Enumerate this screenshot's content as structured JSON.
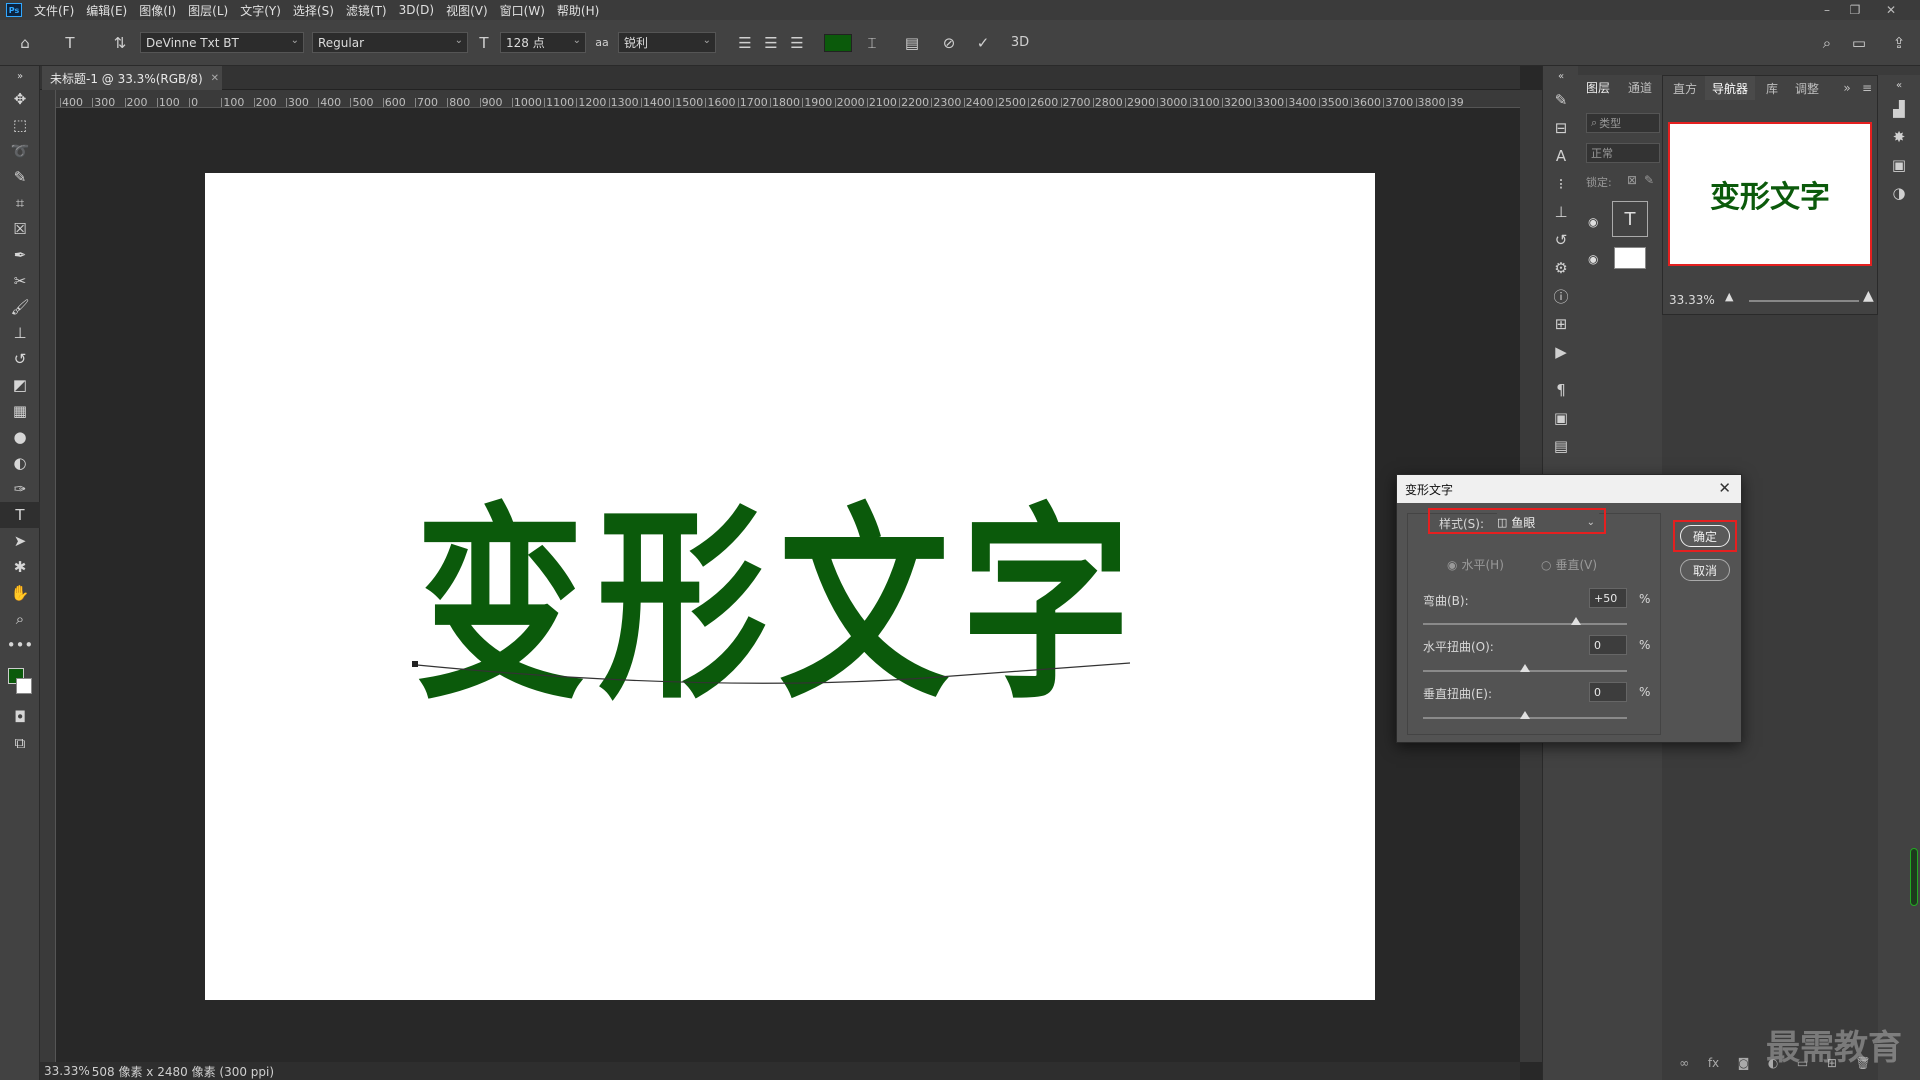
{
  "menubar": {
    "logo": "Ps",
    "items": [
      "文件(F)",
      "编辑(E)",
      "图像(I)",
      "图层(L)",
      "文字(Y)",
      "选择(S)",
      "滤镜(T)",
      "3D(D)",
      "视图(V)",
      "窗口(W)",
      "帮助(H)"
    ]
  },
  "options": {
    "font_family": "DeVinne Txt BT",
    "font_style": "Regular",
    "font_size": "128 点",
    "aa_label": "aa",
    "antialias": "锐利",
    "text_color": "#0b5a0b",
    "threed_label": "3D"
  },
  "document": {
    "tab_title": "未标题-1 @ 33.3%(RGB/8)",
    "canvas_text": "变形文字",
    "text_color": "#0b5a0b"
  },
  "ruler": {
    "h_labels": [
      "400",
      "300",
      "200",
      "100",
      "0",
      "100",
      "200",
      "300",
      "400",
      "500",
      "600",
      "700",
      "800",
      "900",
      "1000",
      "1100",
      "1200",
      "1300",
      "1400",
      "1500",
      "1600",
      "1700",
      "1800",
      "1900",
      "2000",
      "2100",
      "2200",
      "2300",
      "2400",
      "2500",
      "2600",
      "2700",
      "2800",
      "2900",
      "3000",
      "3100",
      "3200",
      "3300",
      "3400",
      "3500",
      "3600",
      "3700",
      "3800",
      "39"
    ]
  },
  "status": {
    "zoom": "33.33%",
    "doc_size": "508 像素 x 2480 像素 (300 ppi)"
  },
  "panels": {
    "tabs_left": [
      "图层",
      "通道"
    ],
    "tabs_right": [
      "直方",
      "导航器",
      "库",
      "调整"
    ],
    "search_label": "类型",
    "blend_mode": "正常",
    "lock_label": "锁定:",
    "layer_text_icon": "T",
    "nav_zoom": "33.33%",
    "nav_thumb_text": "变形文字"
  },
  "dialog": {
    "title": "变形文字",
    "style_label": "样式(S):",
    "style_value": "鱼眼",
    "horizontal_label": "水平(H)",
    "vertical_label": "垂直(V)",
    "bend_label": "弯曲(B):",
    "bend_value": "+50",
    "bend_percent": 50,
    "hdist_label": "水平扭曲(O):",
    "hdist_value": "0",
    "vdist_label": "垂直扭曲(E):",
    "vdist_value": "0",
    "percent": "%",
    "ok_label": "确定",
    "cancel_label": "取消"
  },
  "watermark": "最需教育"
}
